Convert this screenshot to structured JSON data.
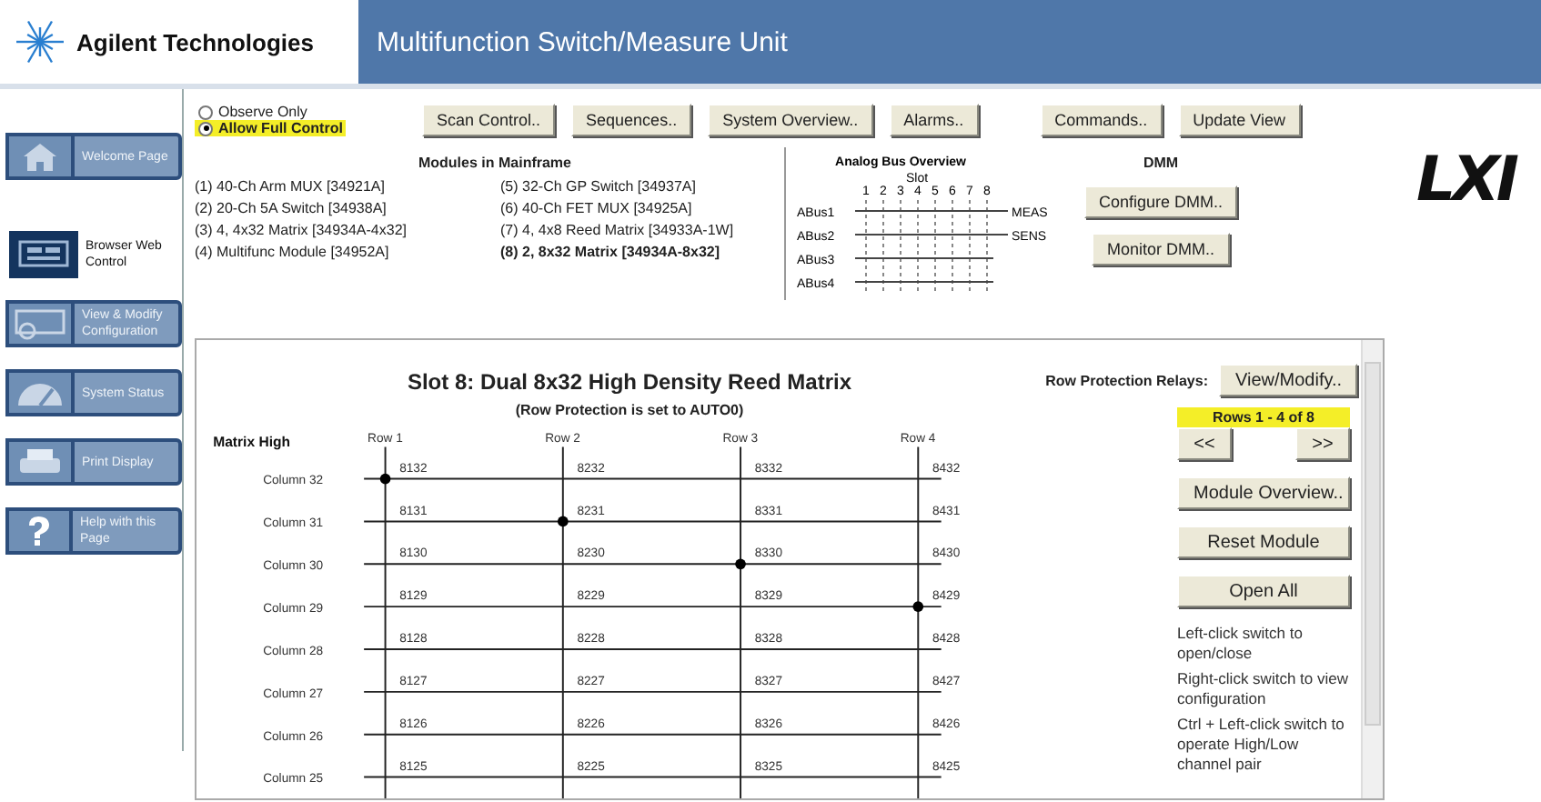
{
  "header": {
    "company": "Agilent Technologies",
    "title": "Multifunction Switch/Measure Unit"
  },
  "nav": [
    {
      "kind": "home",
      "label": "Welcome Page",
      "selected": false
    },
    {
      "kind": "browser",
      "label": "Browser Web Control",
      "selected": true
    },
    {
      "kind": "config",
      "label": "View & Modify Configuration",
      "selected": false
    },
    {
      "kind": "status",
      "label": "System Status",
      "selected": false
    },
    {
      "kind": "print",
      "label": "Print Display",
      "selected": false
    },
    {
      "kind": "help",
      "label": "Help with this Page",
      "selected": false
    }
  ],
  "control_mode": [
    {
      "label": "Observe Only",
      "selected": false
    },
    {
      "label": "Allow Full Control",
      "selected": true
    }
  ],
  "toolbar": [
    "Scan Control..",
    "Sequences..",
    "System Overview..",
    "Alarms..",
    "Commands..",
    "Update View"
  ],
  "logo": "LXI",
  "modules": {
    "title": "Modules in Mainframe",
    "items": [
      {
        "label": "(1) 40-Ch Arm MUX [34921A]",
        "selected": false
      },
      {
        "label": "(2) 20-Ch 5A Switch [34938A]",
        "selected": false
      },
      {
        "label": "(3) 4, 4x32 Matrix [34934A-4x32]",
        "selected": false
      },
      {
        "label": "(4) Multifunc Module [34952A]",
        "selected": false
      },
      {
        "label": "(5) 32-Ch GP Switch [34937A]",
        "selected": false
      },
      {
        "label": "(6) 40-Ch FET MUX [34925A]",
        "selected": false
      },
      {
        "label": "(7) 4, 4x8 Reed Matrix [34933A-1W]",
        "selected": false
      },
      {
        "label": "(8) 2, 8x32 Matrix [34934A-8x32]",
        "selected": true
      }
    ]
  },
  "analog_bus": {
    "title": "Analog Bus Overview",
    "slot_label": "Slot",
    "slots": [
      "1",
      "2",
      "3",
      "4",
      "5",
      "6",
      "7",
      "8"
    ],
    "buses": [
      "ABus1",
      "ABus2",
      "ABus3",
      "ABus4"
    ],
    "outputs": [
      "MEAS",
      "SENS"
    ]
  },
  "dmm": {
    "title": "DMM",
    "buttons": [
      "Configure DMM..",
      "Monitor DMM.."
    ]
  },
  "panel": {
    "title": "Slot 8: Dual 8x32 High Density Reed Matrix",
    "subtitle": "(Row Protection is set to AUTO0)",
    "relays_label": "Row Protection Relays:",
    "relays_button": "View/Modify..",
    "rows_range": "Rows 1 - 4 of 8",
    "prev": "<<",
    "next": ">>",
    "buttons": [
      "Module Overview..",
      "Reset Module",
      "Open All"
    ],
    "help": [
      "Left-click switch to open/close",
      "Right-click switch to view configuration",
      "Ctrl + Left-click switch to operate High/Low channel pair"
    ]
  },
  "matrix": {
    "title": "Matrix High",
    "rows": [
      "Row 1",
      "Row 2",
      "Row 3",
      "Row 4"
    ],
    "columns": [
      {
        "label": "Column 32",
        "channels": [
          {
            "label": "8132",
            "closed": true
          },
          {
            "label": "8232",
            "closed": false
          },
          {
            "label": "8332",
            "closed": false
          },
          {
            "label": "8432",
            "closed": false
          }
        ]
      },
      {
        "label": "Column 31",
        "channels": [
          {
            "label": "8131",
            "closed": false
          },
          {
            "label": "8231",
            "closed": true
          },
          {
            "label": "8331",
            "closed": false
          },
          {
            "label": "8431",
            "closed": false
          }
        ]
      },
      {
        "label": "Column 30",
        "channels": [
          {
            "label": "8130",
            "closed": false
          },
          {
            "label": "8230",
            "closed": false
          },
          {
            "label": "8330",
            "closed": true
          },
          {
            "label": "8430",
            "closed": false
          }
        ]
      },
      {
        "label": "Column 29",
        "channels": [
          {
            "label": "8129",
            "closed": false
          },
          {
            "label": "8229",
            "closed": false
          },
          {
            "label": "8329",
            "closed": false
          },
          {
            "label": "8429",
            "closed": true
          }
        ]
      },
      {
        "label": "Column 28",
        "channels": [
          {
            "label": "8128",
            "closed": false
          },
          {
            "label": "8228",
            "closed": false
          },
          {
            "label": "8328",
            "closed": false
          },
          {
            "label": "8428",
            "closed": false
          }
        ]
      },
      {
        "label": "Column 27",
        "channels": [
          {
            "label": "8127",
            "closed": false
          },
          {
            "label": "8227",
            "closed": false
          },
          {
            "label": "8327",
            "closed": false
          },
          {
            "label": "8427",
            "closed": false
          }
        ]
      },
      {
        "label": "Column 26",
        "channels": [
          {
            "label": "8126",
            "closed": false
          },
          {
            "label": "8226",
            "closed": false
          },
          {
            "label": "8326",
            "closed": false
          },
          {
            "label": "8426",
            "closed": false
          }
        ]
      },
      {
        "label": "Column 25",
        "channels": [
          {
            "label": "8125",
            "closed": false
          },
          {
            "label": "8225",
            "closed": false
          },
          {
            "label": "8325",
            "closed": false
          },
          {
            "label": "8425",
            "closed": false
          }
        ]
      }
    ]
  }
}
